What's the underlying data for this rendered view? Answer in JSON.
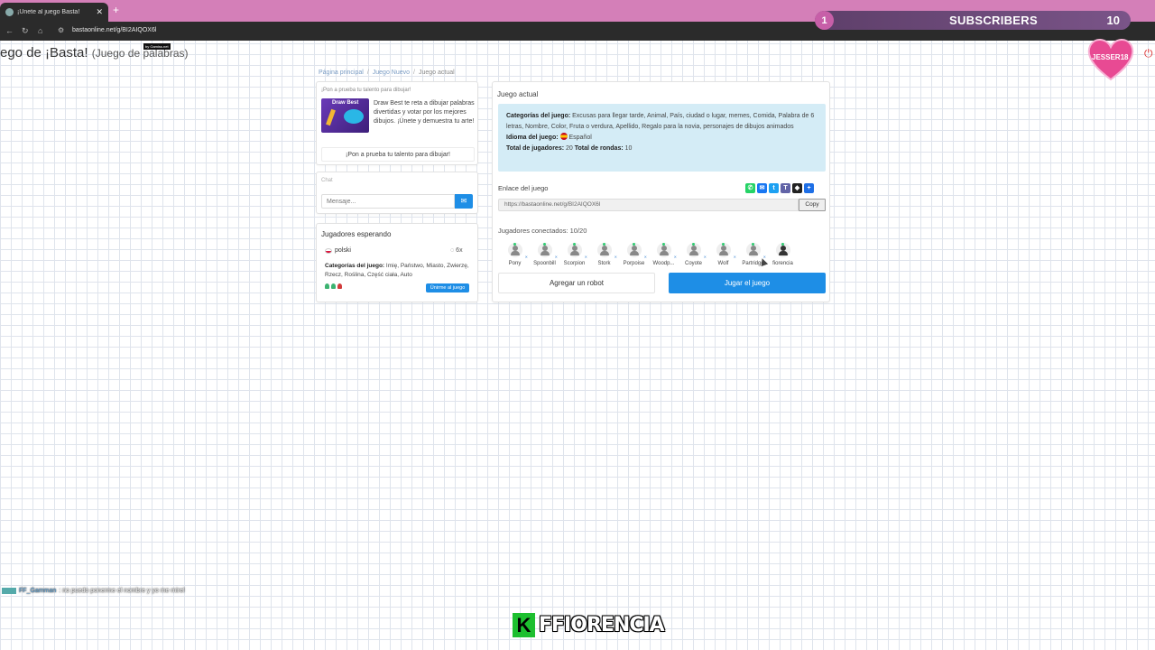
{
  "browser": {
    "tab_title": "¡Únete al juego Basta!",
    "url": "bastaonline.net/g/BI2AIQOX6l"
  },
  "overlay": {
    "subs_left": "1",
    "subs_label": "SUBSCRIBERS",
    "subs_right": "10",
    "heart_label": "JESSER18",
    "byline": "by Gamiss.net",
    "chat_user": "FF_Gamman",
    "chat_message": ": no puedo ponerme el nombre y yo me mirel",
    "brand_letter": "K",
    "brand_name": "FFIORENCIA"
  },
  "header": {
    "title": "ego de ¡Basta!",
    "subtitle": "(Juego de palabras)"
  },
  "breadcrumb": {
    "home": "Página principal",
    "new_game": "Juego Nuevo",
    "current": "Juego actual"
  },
  "promo": {
    "heading": "¡Pon a prueba tu talento para dibujar!",
    "image_label": "Draw Best",
    "description": "Draw Best te reta a dibujar palabras divertidas y votar por los mejores dibujos. ¡Únete y demuestra tu arte!",
    "cta": "¡Pon a prueba tu talento para dibujar!"
  },
  "chat": {
    "heading": "Chat",
    "placeholder": "Mensaje..."
  },
  "waiting": {
    "heading": "Jugadores esperando",
    "language": "polski",
    "rounds": "6x",
    "categories_label": "Categorías del juego:",
    "categories": "Imię, Państwo, Miasto, Zwierzę, Rzecz, Roślina, Część ciała, Auto",
    "join": "Únirme al juego"
  },
  "game": {
    "title": "Juego actual",
    "categories_label": "Categorías del juego:",
    "categories": "Excusas para llegar tarde, Animal, País, ciudad o lugar, memes, Comida, Palabra de 6 letras, Nombre, Color, Fruta o verdura, Apellido, Regalo para la novia, personajes de dibujos animados",
    "language_label": "Idioma del juego:",
    "language": "Español",
    "players_label": "Total de jugadores:",
    "players": "20",
    "rounds_label": "Total de rondas:",
    "rounds": "10",
    "link_label": "Enlace del juego",
    "link": "https://bastaonline.net/g/BI2AIQOX6l",
    "copy": "Copy",
    "connected": "Jugadores conectados: 10/20",
    "player_names": [
      "Pony",
      "Spoonbill",
      "Scorpion",
      "Stork",
      "Porpoise",
      "Woodp...",
      "Coyote",
      "Wolf",
      "Partridge",
      "fiorencia"
    ],
    "add_robot": "Agregar un robot",
    "play": "Jugar el juego"
  },
  "colors": {
    "accent": "#1e8ee6",
    "info_bg": "#d4ecf6",
    "tabstrip": "#d47fb8"
  }
}
